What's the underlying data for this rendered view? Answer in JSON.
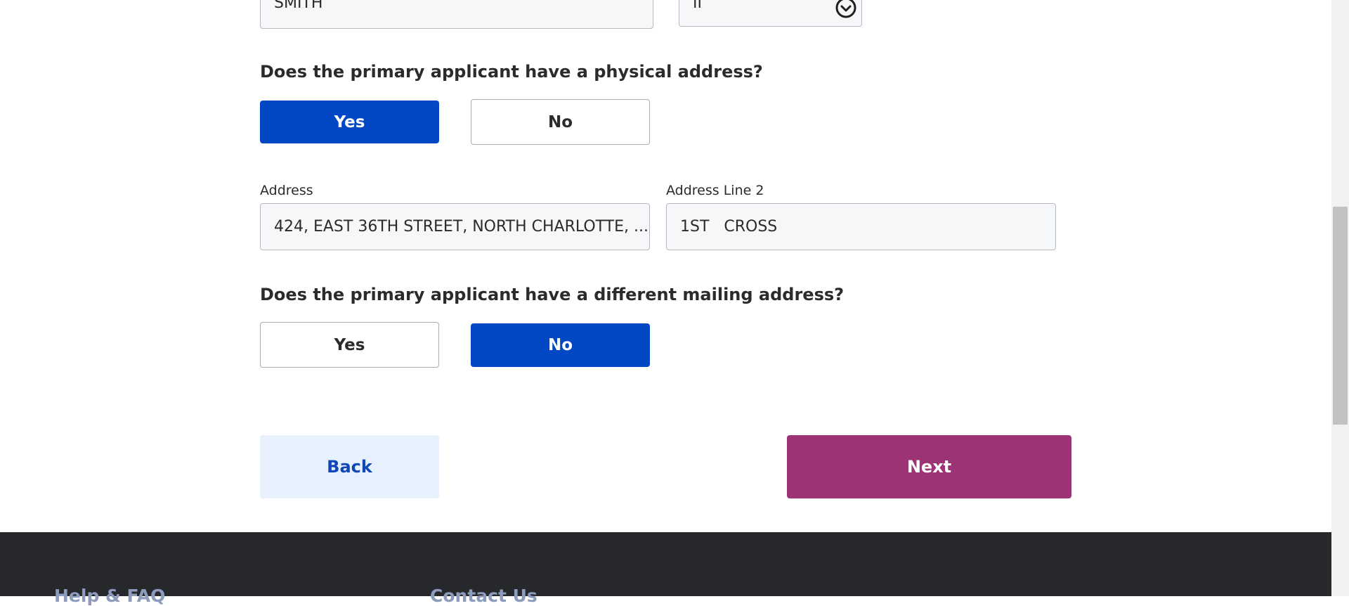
{
  "name_row": {
    "last_name_value": "SMITH",
    "suffix_value": "II",
    "suffix_icon": "chevron-down-circle-icon"
  },
  "physical_address": {
    "question": "Does the primary applicant have a physical address?",
    "yes_label": "Yes",
    "no_label": "No",
    "selected": "Yes"
  },
  "address": {
    "label": "Address",
    "value": "424, EAST 36TH STREET, NORTH CHARLOTTE, ..."
  },
  "address_line2": {
    "label": "Address Line 2",
    "value": "1ST   CROSS"
  },
  "mailing_address": {
    "question": "Does the primary applicant have a different mailing address?",
    "yes_label": "Yes",
    "no_label": "No",
    "selected": "No"
  },
  "nav": {
    "back_label": "Back",
    "next_label": "Next"
  },
  "footer": {
    "help_label": "Help & FAQ",
    "contact_label": "Contact Us"
  },
  "colors": {
    "selected_toggle": "#0248c4",
    "next_button": "#9c3375",
    "back_button_bg": "#e6f1fd",
    "back_button_text": "#0d47b8",
    "footer_bg": "#27282b"
  }
}
